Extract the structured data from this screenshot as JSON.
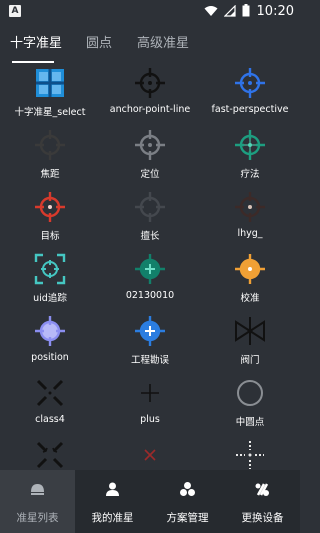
{
  "status_bar": {
    "app_badge": "A",
    "time": "10:20"
  },
  "tabs": [
    "十字准星",
    "圆点",
    "高级准星"
  ],
  "active_tab": 0,
  "crosshairs": [
    {
      "label": "十字准星_select",
      "icon": "blue-square-cross-icon",
      "color": "#1f8ed8"
    },
    {
      "label": "anchor-point-line",
      "icon": "black-circle-crosshair-icon",
      "color": "#111111"
    },
    {
      "label": "fast-perspective",
      "icon": "blue-circle-crosshair-icon",
      "color": "#2f73e8"
    },
    {
      "label": "焦距",
      "icon": "dark-circle-crosshair-icon",
      "color": "#3a3a3a"
    },
    {
      "label": "定位",
      "icon": "gray-circle-crosshair-icon",
      "color": "#7b7f85"
    },
    {
      "label": "疗法",
      "icon": "teal-circle-crosshair-icon",
      "color": "#1d9e80"
    },
    {
      "label": "目标",
      "icon": "red-circle-crosshair-icon",
      "color": "#d83a2c"
    },
    {
      "label": "擅长",
      "icon": "darkgray-circle-crosshair-icon",
      "color": "#44484e"
    },
    {
      "label": "lhyg_",
      "icon": "brown-circle-crosshair-icon",
      "color": "#3c2a28"
    },
    {
      "label": "uid追踪",
      "icon": "cyan-bracket-crosshair-icon",
      "color": "#45c7c2"
    },
    {
      "label": "02130010",
      "icon": "green-circle-crosshair-icon",
      "color": "#12806a"
    },
    {
      "label": "校准",
      "icon": "orange-circle-crosshair-icon",
      "color": "#f0a035"
    },
    {
      "label": "position",
      "icon": "lavender-circle-crosshair-icon",
      "color": "#8b8ef0"
    },
    {
      "label": "工程勘误",
      "icon": "blue-filled-plus-crosshair-icon",
      "color": "#2b7de0"
    },
    {
      "label": "阀门",
      "icon": "valve-crosshair-icon",
      "color": "#111111"
    },
    {
      "label": "class4",
      "icon": "black-x-crosshair-icon",
      "color": "#111111"
    },
    {
      "label": "plus",
      "icon": "black-plus-icon",
      "color": "#111111"
    },
    {
      "label": "中圆点",
      "icon": "gray-ring-icon",
      "color": "#8a8e93"
    },
    {
      "label": "",
      "icon": "black-arrow-x-icon",
      "color": "#111111"
    },
    {
      "label": "",
      "icon": "red-small-x-icon",
      "color": "#9c2a2a"
    },
    {
      "label": "",
      "icon": "white-dotted-cross-icon",
      "color": "#e8e8e8"
    }
  ],
  "bottom_nav": [
    {
      "label": "准星列表",
      "icon": "crosshair-list-icon"
    },
    {
      "label": "我的准星",
      "icon": "user-icon"
    },
    {
      "label": "方案管理",
      "icon": "scheme-icon"
    },
    {
      "label": "更换设备",
      "icon": "switch-device-icon"
    }
  ],
  "active_nav": 0
}
